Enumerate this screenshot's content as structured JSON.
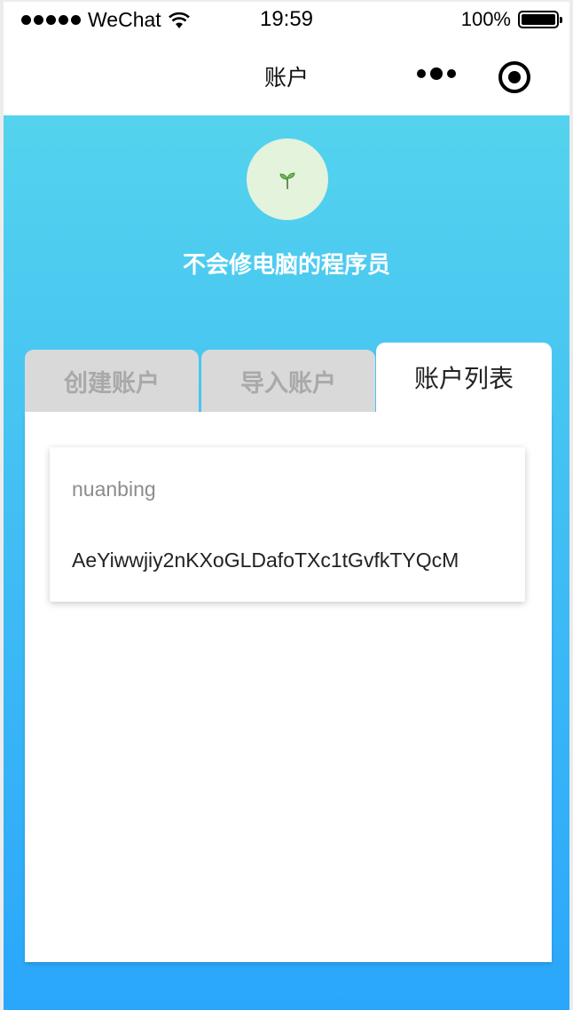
{
  "status_bar": {
    "carrier": "WeChat",
    "time": "19:59",
    "battery": "100%"
  },
  "nav": {
    "title": "账户"
  },
  "profile": {
    "username": "不会修电脑的程序员",
    "avatar_icon": "sprout-icon"
  },
  "tabs": [
    {
      "label": "创建账户"
    },
    {
      "label": "导入账户"
    },
    {
      "label": "账户列表"
    }
  ],
  "active_tab": "账户列表",
  "accounts": [
    {
      "name": "nuanbing",
      "public_key": "AeYiwwjiy2nKXoGLDafoTXc1tGvfkTYQcM"
    }
  ],
  "colors": {
    "gradient_top": "#54d3ee",
    "gradient_bottom": "#2aa6fb",
    "tab_inactive_bg": "#d9d9d9",
    "tab_inactive_text": "#a9a9a9"
  }
}
